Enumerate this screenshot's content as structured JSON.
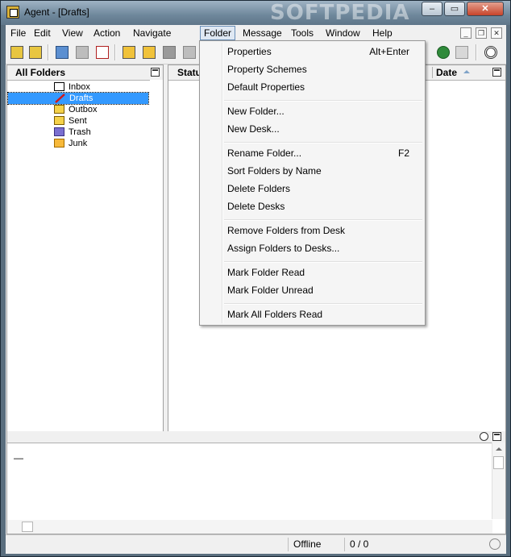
{
  "window": {
    "title": "Agent - [Drafts]",
    "watermark": "SOFTPEDIA",
    "controls": [
      "minimize-icon",
      "maximize-icon",
      "close-icon"
    ]
  },
  "menubar": {
    "items": [
      {
        "label": "File"
      },
      {
        "label": "Edit"
      },
      {
        "label": "View"
      },
      {
        "label": "Action"
      },
      {
        "label": "Navigate"
      },
      {
        "label": "Folder"
      },
      {
        "label": "Message"
      },
      {
        "label": "Tools"
      },
      {
        "label": "Window"
      },
      {
        "label": "Help"
      }
    ],
    "active": "Folder"
  },
  "folders_pane": {
    "header": "All Folders",
    "items": [
      {
        "label": "Inbox",
        "icon": "inbox-envelope-icon"
      },
      {
        "label": "Drafts",
        "icon": "drafts-pencil-icon",
        "selected": true
      },
      {
        "label": "Outbox",
        "icon": "outbox-icon"
      },
      {
        "label": "Sent",
        "icon": "sent-icon"
      },
      {
        "label": "Trash",
        "icon": "trash-icon"
      },
      {
        "label": "Junk",
        "icon": "junk-folder-icon"
      }
    ]
  },
  "message_list": {
    "columns": [
      {
        "label": "Status"
      },
      {
        "label": "Date",
        "sort": "ascending"
      }
    ]
  },
  "folder_menu": {
    "groups": [
      [
        {
          "label": "Properties",
          "shortcut": "Alt+Enter"
        },
        {
          "label": "Property Schemes",
          "shortcut": ""
        },
        {
          "label": "Default Properties",
          "shortcut": ""
        }
      ],
      [
        {
          "label": "New Folder...",
          "shortcut": ""
        },
        {
          "label": "New Desk...",
          "shortcut": ""
        }
      ],
      [
        {
          "label": "Rename Folder...",
          "shortcut": "F2"
        },
        {
          "label": "Sort Folders by Name",
          "shortcut": ""
        },
        {
          "label": "Delete Folders",
          "shortcut": ""
        },
        {
          "label": "Delete Desks",
          "shortcut": ""
        }
      ],
      [
        {
          "label": "Remove Folders from Desk",
          "shortcut": ""
        },
        {
          "label": "Assign Folders to Desks...",
          "shortcut": ""
        }
      ],
      [
        {
          "label": "Mark Folder Read",
          "shortcut": ""
        },
        {
          "label": "Mark Folder Unread",
          "shortcut": ""
        }
      ],
      [
        {
          "label": "Mark All Folders Read",
          "shortcut": ""
        }
      ]
    ]
  },
  "preview_pane": {
    "text": "—"
  },
  "statusbar": {
    "state": "Offline",
    "counts": "0 / 0"
  },
  "colors": {
    "selection": "#3399ff",
    "titlebar": "#6e879b",
    "menu_highlight": "#dfe8f3"
  }
}
